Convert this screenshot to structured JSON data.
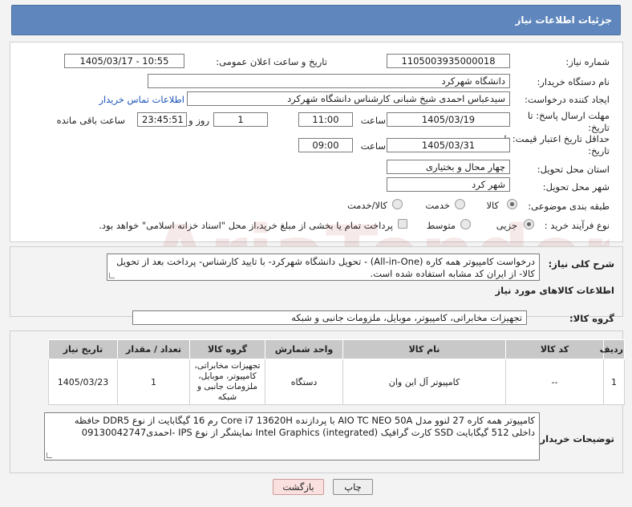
{
  "header": {
    "title": "جزئیات اطلاعات نیاز"
  },
  "form": {
    "need_number_label": "شماره نیاز:",
    "need_number": "1105003935000018",
    "announce_label": "تاریخ و ساعت اعلان عمومی:",
    "announce_value": "1405/03/17 - 10:55",
    "buyer_org_label": "نام دستگاه خریدار:",
    "buyer_org": "دانشگاه شهرکرد",
    "creator_label": "ایجاد کننده درخواست:",
    "creator": "سیدعباس احمدی شیخ شبانی کارشناس دانشگاه شهرکرد",
    "contact_link": "اطلاعات تماس خریدار",
    "deadline_label": "مهلت ارسال پاسخ: تا تاریخ:",
    "deadline_date": "1405/03/19",
    "time_label": "ساعت",
    "deadline_time": "11:00",
    "days_value": "1",
    "days_label": "روز و",
    "remaining_time": "23:45:51",
    "remaining_label": "ساعت باقی مانده",
    "validity_label": "حداقل تاریخ اعتبار قیمت: تا تاریخ:",
    "validity_date": "1405/03/31",
    "validity_time": "09:00",
    "province_label": "استان محل تحویل:",
    "province": "چهار محال و بختیاری",
    "city_label": "شهر محل تحویل:",
    "city": "شهر کرد",
    "category_label": "طبقه بندی موضوعی:",
    "category_options": [
      "کالا",
      "خدمت",
      "کالا/خدمت"
    ],
    "process_label": "نوع فرآیند خرید :",
    "process_options": [
      "جزیی",
      "متوسط"
    ],
    "payment_note": "پرداخت تمام یا بخشی از مبلغ خرید،از محل \"اسناد خزانه اسلامی\" خواهد بود."
  },
  "summary": {
    "label": "شرح کلی نیاز:",
    "text": "درخواست کامپیوتر همه کاره (All-in-One) - تحویل دانشگاه شهرکرد- با تایید کارشناس- پرداخت بعد از تحویل کالا- از ایران کد مشابه استفاده شده است.",
    "goods_info_title": "اطلاعات کالاهای مورد نیاز",
    "goods_group_label": "گروه کالا:",
    "goods_group": "تجهیزات مخابراتی، کامپیوتر، موبایل، ملزومات جانبی و شبکه"
  },
  "table": {
    "headers": [
      "ردیف",
      "کد کالا",
      "نام کالا",
      "واحد شمارش",
      "گروه کالا",
      "تعداد / مقدار",
      "تاریخ نیاز"
    ],
    "rows": [
      [
        "1",
        "--",
        "کامپیوتر آل این وان",
        "دستگاه",
        "تجهیزات مخابراتی، کامپیوتر، موبایل، ملزومات جانبی و شبکه",
        "1",
        "1405/03/23"
      ]
    ]
  },
  "buyer_notes": {
    "label": "توضیحات خریدار:",
    "text": "کامپیوتر همه کاره 27 لنوو مدل AIO TC NEO 50A با پردازنده Core i7 13620H رم 16 گیگابایت از نوع DDR5 حافظه داخلی 512 گیگابایت SSD کارت گرافیک Intel Graphics (integrated) نمایشگر از نوع IPS -احمدی09130042747"
  },
  "buttons": {
    "print": "چاپ",
    "back": "بازگشت"
  },
  "colors": {
    "header_bg": "#5f87bd",
    "link": "#1b53b8"
  }
}
